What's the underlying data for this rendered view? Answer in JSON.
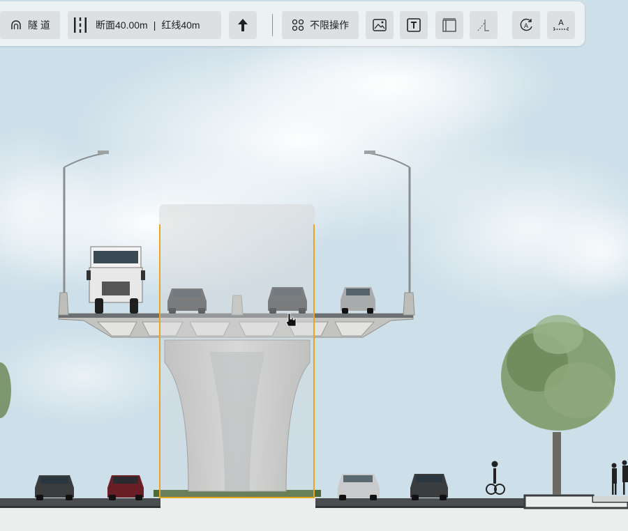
{
  "toolbar": {
    "tunnel_label": "隧 道",
    "section_label": "断面40.00m",
    "separator": "|",
    "redline_label": "红线40m",
    "ops_label": "不限操作",
    "tools": [
      {
        "name": "direction-arrow",
        "icon": "arrow-up-icon"
      },
      {
        "name": "ops",
        "icon": "grid-circles-icon"
      },
      {
        "name": "image",
        "icon": "image-icon"
      },
      {
        "name": "text",
        "icon": "text-box-icon"
      },
      {
        "name": "frame",
        "icon": "frame-icon"
      },
      {
        "name": "slope",
        "icon": "slope-icon"
      },
      {
        "name": "auto-annotate",
        "icon": "rotate-a-icon"
      },
      {
        "name": "dimension",
        "icon": "dimension-a-icon"
      }
    ],
    "dimension_letter": "A",
    "rotate_letter": "A",
    "text_letter": "T"
  },
  "scene": {
    "description_colors": {
      "sky": "#cfe0ea",
      "selection": "#e5a620",
      "concrete": "#c9c9c6",
      "road": "#4a4d50",
      "ground": "#eceeed"
    }
  }
}
